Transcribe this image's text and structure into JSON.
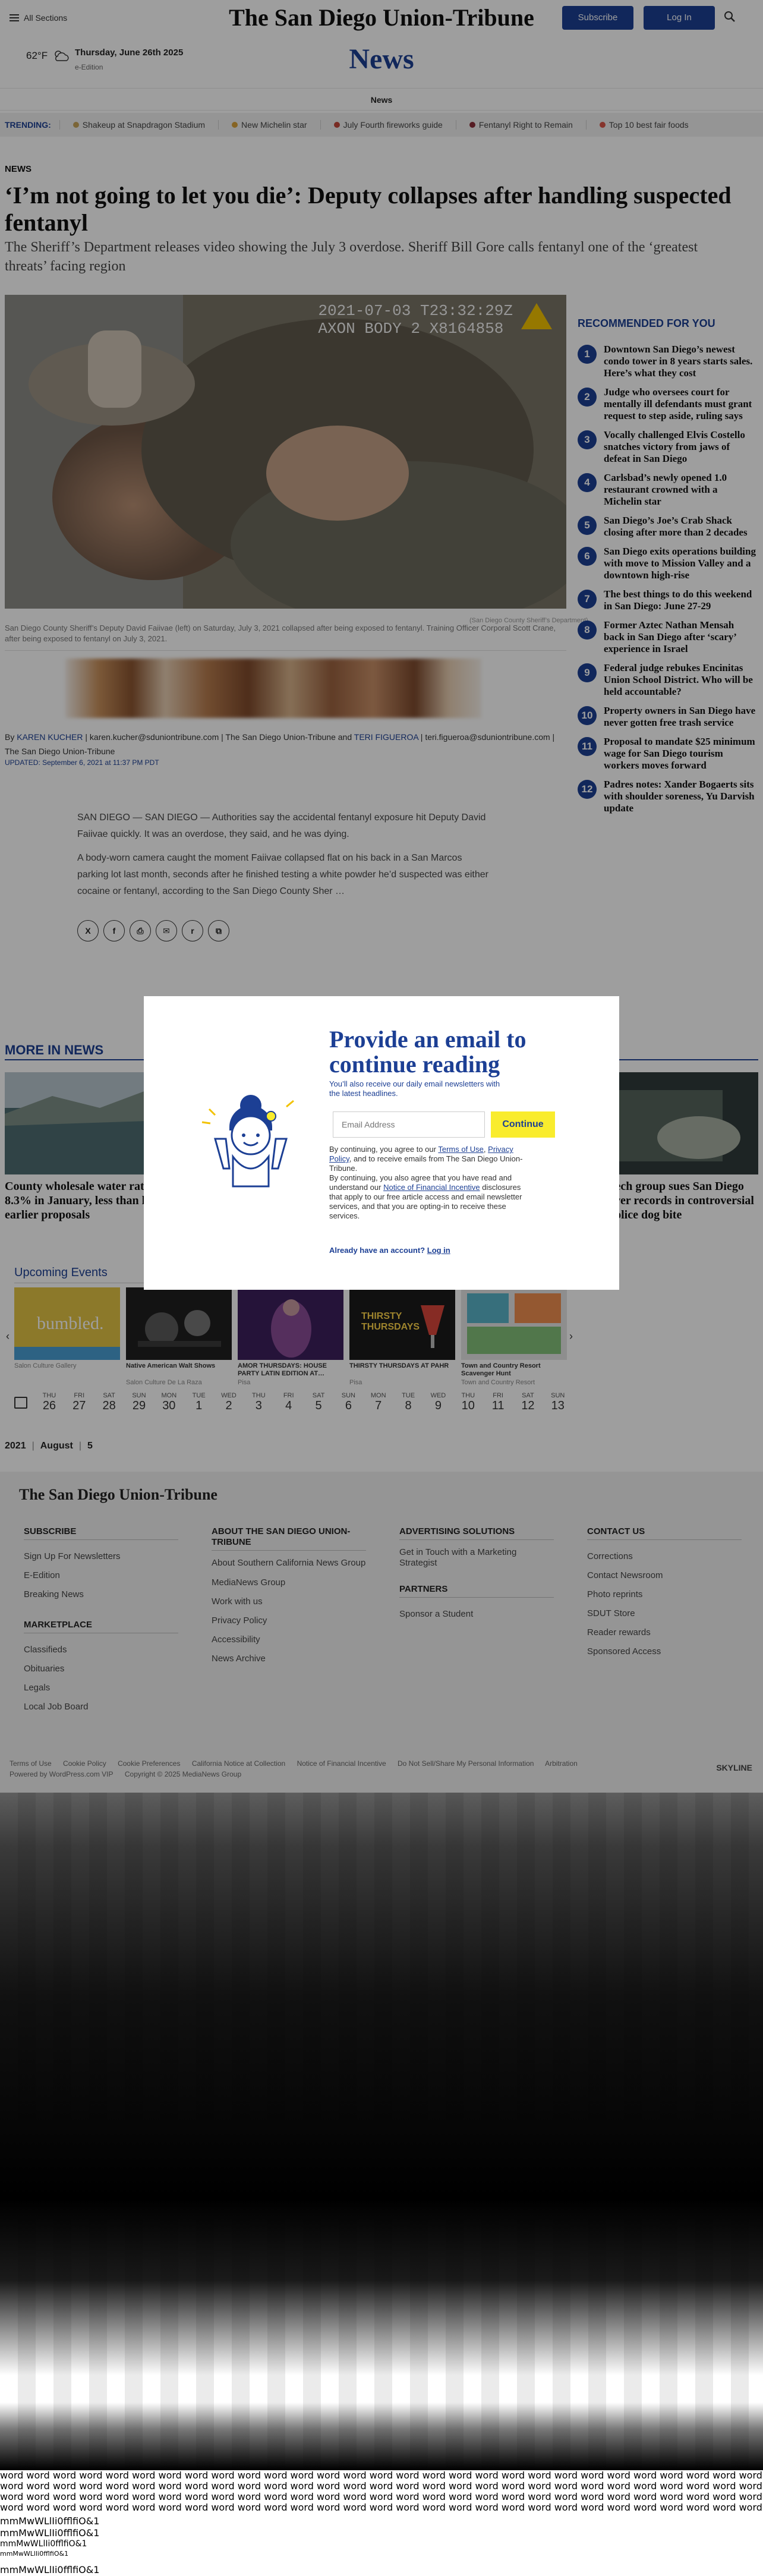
{
  "header": {
    "all_sections": "All Sections",
    "logo": "The San Diego Union-Tribune",
    "subscribe": "Subscribe",
    "login": "Log In",
    "temperature": "62°F",
    "date": "Thursday, June 26th 2025",
    "edition": "e-Edition",
    "section_title": "News",
    "subnav": "News"
  },
  "trending": {
    "label": "TRENDING:",
    "items": [
      {
        "label": "Shakeup at Snapdragon Stadium",
        "color": "#c7a45a"
      },
      {
        "label": "New Michelin star",
        "color": "#d9a23a"
      },
      {
        "label": "July Fourth fireworks guide",
        "color": "#c4473a"
      },
      {
        "label": "Fentanyl Right to Remain",
        "color": "#8c2f3a"
      },
      {
        "label": "Top 10 best fair foods",
        "color": "#d8564a"
      }
    ]
  },
  "article": {
    "kicker": "NEWS",
    "headline": "‘I’m not going to let you die’: Deputy collapses after handling suspected fentanyl",
    "dek": "The Sheriff’s Department releases video showing the July 3 overdose. Sheriff Bill Gore calls fentanyl one of the ‘greatest threats’ facing region",
    "hero_stamp_line1": "2021-07-03 T23:32:29Z",
    "hero_stamp_line2": "AXON BODY 2 X8164858",
    "credit": "(San Diego County Sheriff’s Department)",
    "caption": "San Diego County Sheriff’s Deputy David Faiivae (left) on Saturday, July 3, 2021 collapsed after being exposed to fentanyl. Training Officer Corporal Scott Crane, after being exposed to fentanyl on July 3, 2021.",
    "byline_prefix": "By",
    "author1": "KAREN KUCHER",
    "author1_email": "karen.kucher@sduniontribune.com",
    "byline_pub1": "The San Diego Union-Tribune and",
    "author2": "TERI FIGUEROA",
    "author2_email": "teri.figueroa@sduniontribune.com",
    "byline_pub2": "The San Diego Union-Tribune",
    "updated": "UPDATED: September 6, 2021 at 11:37 PM PDT",
    "p1": "SAN DIEGO — SAN DIEGO — Authorities say the accidental fentanyl exposure hit Deputy David Faiivae quickly. It was an overdose, they said, and he was dying.",
    "p2": "A body-worn camera caught the moment Faiivae collapsed flat on his back in a San Marcos parking lot last month, seconds after he finished testing a white powder he’d suspected was either cocaine or fentanyl, according to the San Diego County Sher …"
  },
  "share_icons": [
    "X",
    "f",
    "⎙",
    "✉",
    "r",
    "⧉"
  ],
  "sidebar": {
    "title": "RECOMMENDED FOR YOU",
    "items": [
      {
        "num": "1",
        "text": "Downtown San Diego’s newest condo tower in 8 years starts sales. Here’s what they cost"
      },
      {
        "num": "2",
        "text": "Judge who oversees court for mentally ill defendants must grant request to step aside, ruling says"
      },
      {
        "num": "3",
        "text": "Vocally challenged Elvis Costello snatches victory from jaws of defeat in San Diego"
      },
      {
        "num": "4",
        "text": "Carlsbad’s newly opened 1.0 restaurant crowned with a Michelin star"
      },
      {
        "num": "5",
        "text": "San Diego’s Joe’s Crab Shack closing after more than 2 decades"
      },
      {
        "num": "6",
        "text": "San Diego exits operations building with move to Mission Valley and a downtown high-rise"
      },
      {
        "num": "7",
        "text": "The best things to do this weekend in San Diego: June 27-29"
      },
      {
        "num": "8",
        "text": "Former Aztec Nathan Mensah back in San Diego after ‘scary’ experience in Israel"
      },
      {
        "num": "9",
        "text": "Federal judge rebukes Encinitas Union School District. Who will be held accountable?"
      },
      {
        "num": "10",
        "text": "Property owners in San Diego have never gotten free trash service"
      },
      {
        "num": "11",
        "text": "Proposal to mandate $25 minimum wage for San Diego tourism workers moves forward"
      },
      {
        "num": "12",
        "text": "Padres notes: Xander Bogaerts sits with shoulder soreness, Yu Darvish update"
      }
    ]
  },
  "more": {
    "title": "MORE IN NEWS",
    "left_text": "County wholesale water rates rise 8.3% in January, less than half of earlier proposals",
    "right_text": "Tech group sues San Diego over records in controversial police dog bite"
  },
  "events": {
    "title": "Upcoming Events",
    "cards": [
      {
        "name": "",
        "venue": "Salon Culture Gallery",
        "label": "bumbled."
      },
      {
        "name": "Native American Walt Shows",
        "venue": "Salon Culture De La Raza",
        "label": ""
      },
      {
        "name": "AMOR THURSDAYS: HOUSE PARTY LATIN EDITION AT…",
        "venue": "Pisa",
        "label": ""
      },
      {
        "name": "THIRSTY THURSDAYS AT PAHR",
        "venue": "Pisa",
        "label": "THIRSTY THURSDAYS"
      },
      {
        "name": "Town and Country Resort Scavenger Hunt",
        "venue": "Town and Country Resort",
        "label": ""
      }
    ],
    "days": [
      {
        "dow": "THU",
        "num": "26"
      },
      {
        "dow": "FRI",
        "num": "27"
      },
      {
        "dow": "SAT",
        "num": "28"
      },
      {
        "dow": "SUN",
        "num": "29"
      },
      {
        "dow": "MON",
        "num": "30"
      },
      {
        "dow": "TUE",
        "num": "1"
      },
      {
        "dow": "WED",
        "num": "2"
      },
      {
        "dow": "THU",
        "num": "3"
      },
      {
        "dow": "FRI",
        "num": "4"
      },
      {
        "dow": "SAT",
        "num": "5"
      },
      {
        "dow": "SUN",
        "num": "6"
      },
      {
        "dow": "MON",
        "num": "7"
      },
      {
        "dow": "TUE",
        "num": "8"
      },
      {
        "dow": "WED",
        "num": "9"
      },
      {
        "dow": "THU",
        "num": "10"
      },
      {
        "dow": "FRI",
        "num": "11"
      },
      {
        "dow": "SAT",
        "num": "12"
      },
      {
        "dow": "SUN",
        "num": "13"
      }
    ]
  },
  "breadcrumb": {
    "year": "2021",
    "month": "August",
    "day": "5"
  },
  "footer": {
    "logo": "The San Diego Union-Tribune",
    "subscribe": {
      "head": "SUBSCRIBE",
      "links": [
        "Sign Up For Newsletters",
        "E-Edition",
        "Breaking News"
      ]
    },
    "marketplace": {
      "head": "MARKETPLACE",
      "links": [
        "Classifieds",
        "Obituaries",
        "Legals",
        "Local Job Board"
      ]
    },
    "about": {
      "head": "ABOUT THE SAN DIEGO UNION-TRIBUNE",
      "links": [
        "About Southern California News Group",
        "MediaNews Group",
        "Work with us",
        "Privacy Policy",
        "Accessibility",
        "News Archive"
      ]
    },
    "advertising": {
      "head": "ADVERTISING SOLUTIONS",
      "links": [
        "Get in Touch with a Marketing Strategist"
      ]
    },
    "partners": {
      "head": "PARTNERS",
      "links": [
        "Sponsor a Student"
      ]
    },
    "contact": {
      "head": "CONTACT US",
      "links": [
        "Corrections",
        "Contact Newsroom",
        "Photo reprints",
        "SDUT Store",
        "Reader rewards",
        "Sponsored Access"
      ]
    },
    "bottom_links": [
      "Terms of Use",
      "Cookie Policy",
      "Cookie Preferences",
      "California Notice at Collection",
      "Notice of Financial Incentive",
      "Do Not Sell/Share My Personal Information",
      "Arbitration"
    ],
    "powered": "Powered by WordPress.com VIP",
    "copyright": "Copyright © 2025 MediaNews Group",
    "skyline": "SKYLINE"
  },
  "modal": {
    "title": "Provide an email to continue reading",
    "sub": "You’ll also receive our daily email newsletters with the latest headlines.",
    "email_placeholder": "Email Address",
    "continue": "Continue",
    "legal1_a": "By continuing, you agree to our",
    "terms": "Terms of Use",
    "privacy": "Privacy Policy",
    "legal1_b": ", and to receive emails from The San Diego Union-Tribune.",
    "legal2_a": "By continuing, you also agree that you have read and understand our",
    "notice": "Notice of Financial Incentive",
    "legal2_b": "disclosures that apply to our free article access and email newsletter services, and that you are opting-in to receive these services.",
    "acct_a": "Already have an account?",
    "acct_login": "Log in"
  },
  "word_lines": {
    "line": "word word word word word word word word word word word word word word word word word word word word word word word word word word word word word word word word word word word word word word word word word word word word word word word word word word word word word word word word word word",
    "glyphs": "mmMwWLlIi0fflfiO&1"
  }
}
